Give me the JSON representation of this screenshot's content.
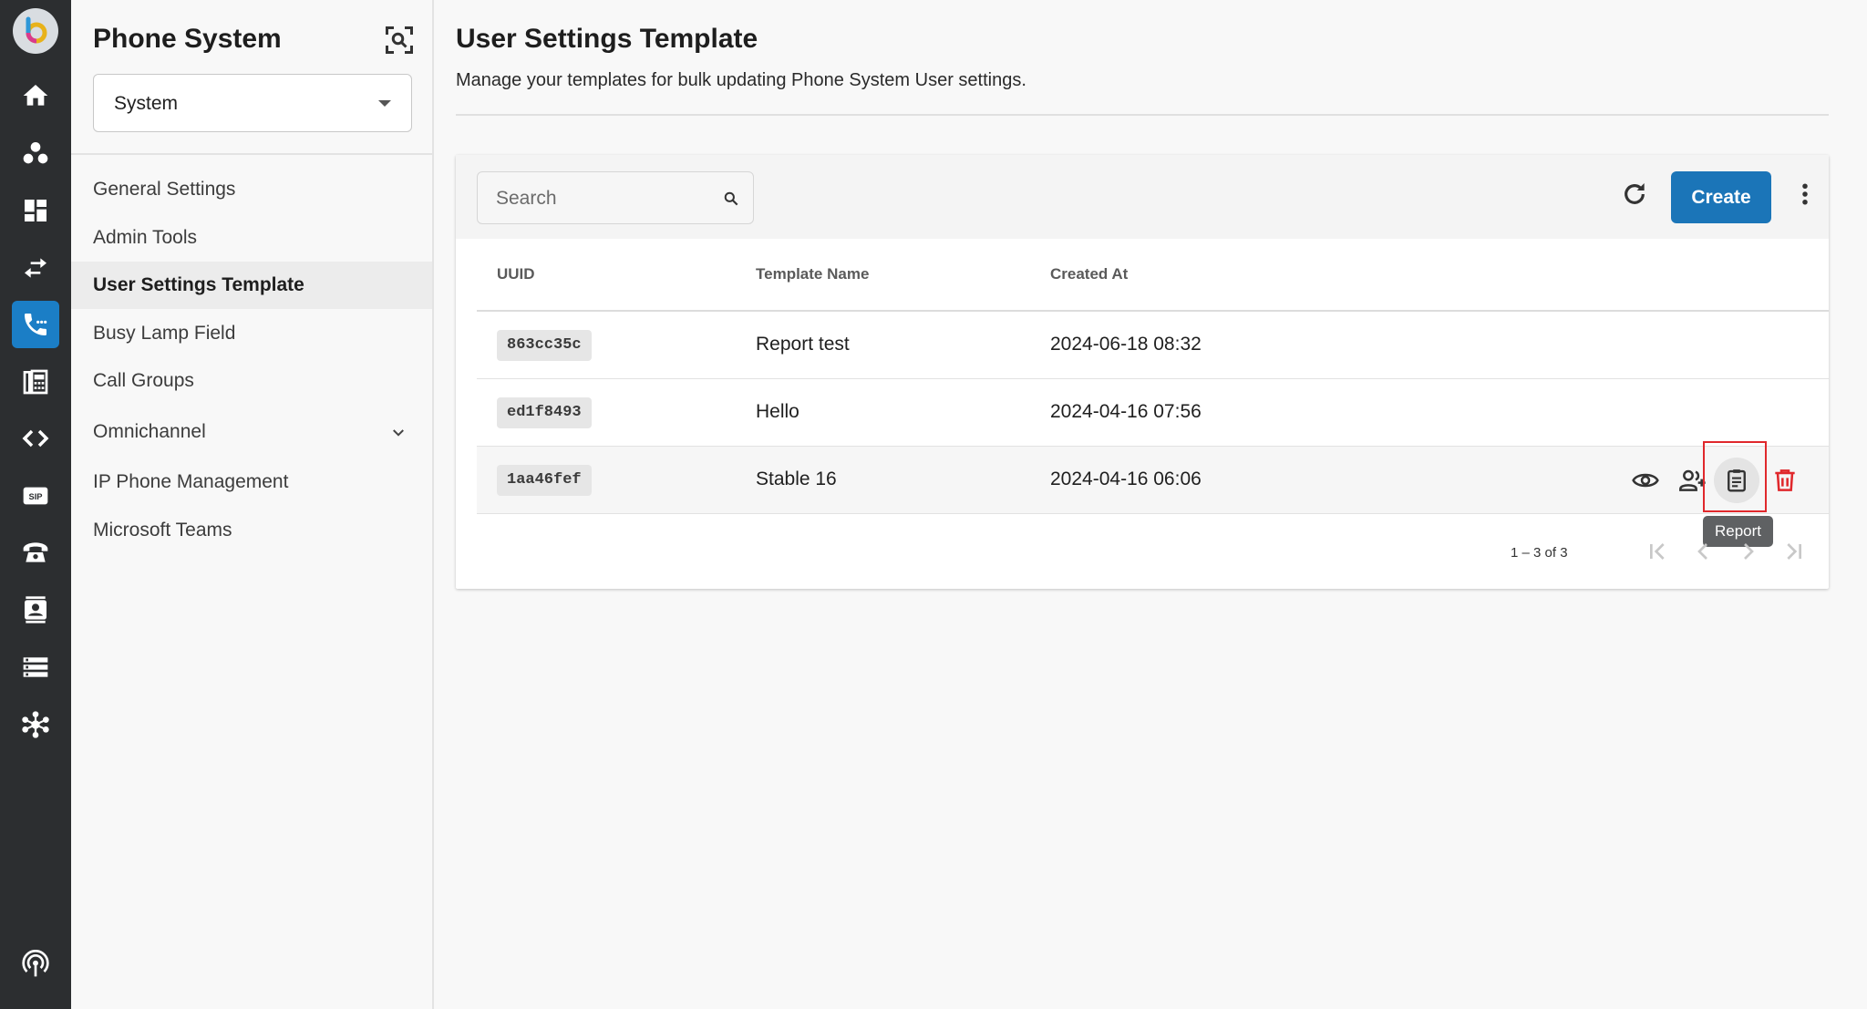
{
  "rail": {
    "items": [
      {
        "icon": "home-icon"
      },
      {
        "icon": "users-icon"
      },
      {
        "icon": "dashboard-icon"
      },
      {
        "icon": "transfer-icon"
      },
      {
        "icon": "phone-icon",
        "active": true
      },
      {
        "icon": "fax-icon"
      },
      {
        "icon": "code-icon"
      },
      {
        "icon": "sip-icon",
        "text": "SIP"
      },
      {
        "icon": "desk-phone-icon"
      },
      {
        "icon": "contacts-icon"
      },
      {
        "icon": "server-list-icon"
      },
      {
        "icon": "network-icon"
      },
      {
        "icon": "broadcast-icon"
      }
    ]
  },
  "sidebar": {
    "title": "Phone System",
    "select_value": "System",
    "items": [
      {
        "label": "General Settings"
      },
      {
        "label": "Admin Tools"
      },
      {
        "label": "User Settings Template",
        "active": true
      },
      {
        "label": "Busy Lamp Field"
      },
      {
        "label": "Call Groups"
      },
      {
        "label": "Omnichannel",
        "expandable": true
      },
      {
        "label": "IP Phone Management"
      },
      {
        "label": "Microsoft Teams"
      }
    ]
  },
  "page": {
    "title": "User Settings Template",
    "subtitle": "Manage your templates for bulk updating Phone System User settings."
  },
  "toolbar": {
    "search_placeholder": "Search",
    "create_label": "Create"
  },
  "table": {
    "columns": [
      "UUID",
      "Template Name",
      "Created At"
    ],
    "rows": [
      {
        "uuid": "863cc35c",
        "name": "Report test",
        "created": "2024-06-18 08:32"
      },
      {
        "uuid": "ed1f8493",
        "name": "Hello",
        "created": "2024-04-16 07:56"
      },
      {
        "uuid": "1aa46fef",
        "name": "Stable 16",
        "created": "2024-04-16 06:06"
      }
    ],
    "tooltip": "Report"
  },
  "pagination": {
    "range_text": "1 – 3 of 3"
  },
  "colors": {
    "accent": "#1b75b8",
    "rail_bg": "#2c2e30",
    "delete": "#e0282c",
    "highlight": "#e0282c"
  }
}
